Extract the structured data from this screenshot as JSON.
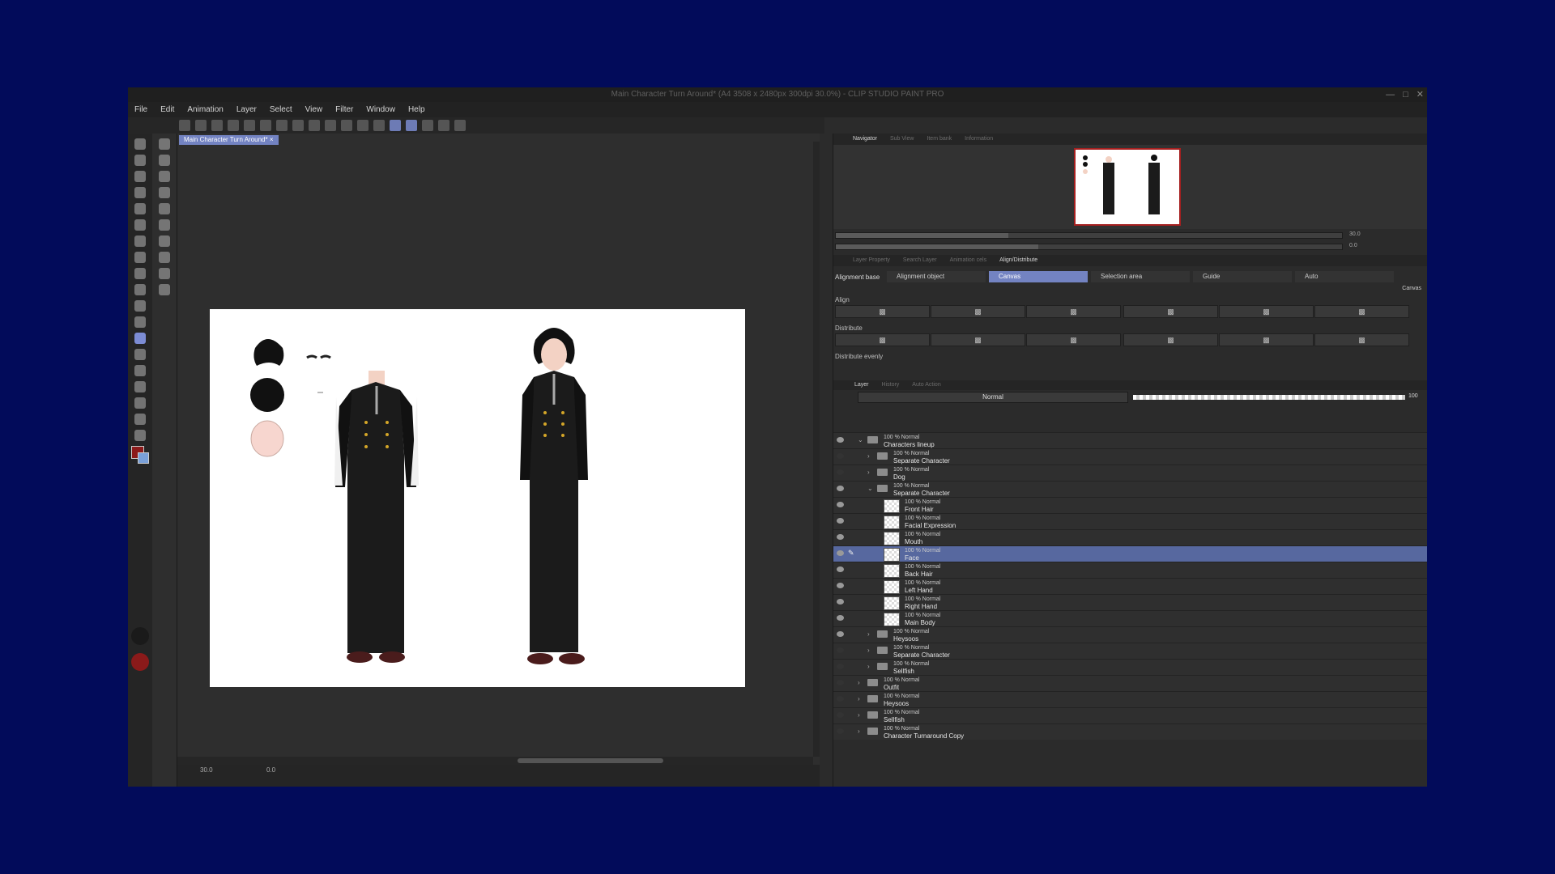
{
  "window": {
    "title": "Main Character Turn Around* (A4 3508 x 2480px 300dpi 30.0%) - CLIP STUDIO PAINT PRO"
  },
  "menu": [
    "File",
    "Edit",
    "Animation",
    "Layer",
    "Select",
    "View",
    "Filter",
    "Window",
    "Help"
  ],
  "canvas": {
    "tab_label": "Main Character Turn Around*",
    "zoom": "30.0",
    "rotation": "0.0"
  },
  "navigator": {
    "tabs": [
      "Navigator",
      "Sub View",
      "Item bank",
      "Information"
    ],
    "zoom": "30.0",
    "rotation": "0.0"
  },
  "align_panel": {
    "tabs": [
      "Layer Property",
      "Search Layer",
      "Animation cels",
      "Align/Distribute"
    ],
    "alignment_base_label": "Alignment base",
    "options": [
      "Alignment object",
      "Canvas",
      "Selection area",
      "Guide",
      "Auto"
    ],
    "selected_option": "Canvas",
    "current_base": "Canvas",
    "align_label": "Align",
    "distribute_label": "Distribute",
    "distribute_evenly_label": "Distribute evenly"
  },
  "layer_panel": {
    "tabs": [
      "Layer",
      "History",
      "Auto Action"
    ],
    "blend_mode": "Normal",
    "opacity": "100",
    "layers": [
      {
        "mode": "100 % Normal",
        "name": "Characters lineup",
        "type": "folder",
        "indent": 0,
        "expanded": true,
        "visible": true
      },
      {
        "mode": "100 % Normal",
        "name": "Separate Character",
        "type": "folder",
        "indent": 1,
        "expanded": false,
        "visible": false
      },
      {
        "mode": "100 % Normal",
        "name": "Dog",
        "type": "folder",
        "indent": 1,
        "expanded": false,
        "visible": false
      },
      {
        "mode": "100 % Normal",
        "name": "Separate Character",
        "type": "folder",
        "indent": 1,
        "expanded": true,
        "visible": true
      },
      {
        "mode": "100 % Normal",
        "name": "Front Hair",
        "type": "layer",
        "indent": 2,
        "visible": true
      },
      {
        "mode": "100 % Normal",
        "name": "Facial Expression",
        "type": "layer",
        "indent": 2,
        "visible": true
      },
      {
        "mode": "100 % Normal",
        "name": "Mouth",
        "type": "layer",
        "indent": 2,
        "visible": true
      },
      {
        "mode": "100 % Normal",
        "name": "Face",
        "type": "layer",
        "indent": 2,
        "visible": true,
        "selected": true
      },
      {
        "mode": "100 % Normal",
        "name": "Back Hair",
        "type": "layer",
        "indent": 2,
        "visible": true
      },
      {
        "mode": "100 % Normal",
        "name": "Left Hand",
        "type": "layer",
        "indent": 2,
        "visible": true
      },
      {
        "mode": "100 % Normal",
        "name": "Right Hand",
        "type": "layer",
        "indent": 2,
        "visible": true
      },
      {
        "mode": "100 % Normal",
        "name": "Main Body",
        "type": "layer",
        "indent": 2,
        "visible": true
      },
      {
        "mode": "100 % Normal",
        "name": "Heysoos",
        "type": "folder",
        "indent": 1,
        "expanded": false,
        "visible": true
      },
      {
        "mode": "100 % Normal",
        "name": "Separate Character",
        "type": "folder",
        "indent": 1,
        "expanded": false,
        "visible": false
      },
      {
        "mode": "100 % Normal",
        "name": "Sellfish",
        "type": "folder",
        "indent": 1,
        "expanded": false,
        "visible": false
      },
      {
        "mode": "100 % Normal",
        "name": "Outfit",
        "type": "folder",
        "indent": 0,
        "expanded": false,
        "visible": false
      },
      {
        "mode": "100 % Normal",
        "name": "Heysoos",
        "type": "folder",
        "indent": 0,
        "expanded": false,
        "visible": false
      },
      {
        "mode": "100 % Normal",
        "name": "Sellfish",
        "type": "folder",
        "indent": 0,
        "expanded": false,
        "visible": false
      },
      {
        "mode": "100 % Normal",
        "name": "Character Turnaround Copy",
        "type": "folder",
        "indent": 0,
        "expanded": false,
        "visible": false
      }
    ]
  },
  "colors": {
    "desktop": "#020b5a",
    "selection": "#57689f",
    "accent": "#7383c2",
    "main_color": "#8b1a1a",
    "sub_color": "#7aa0d8"
  }
}
